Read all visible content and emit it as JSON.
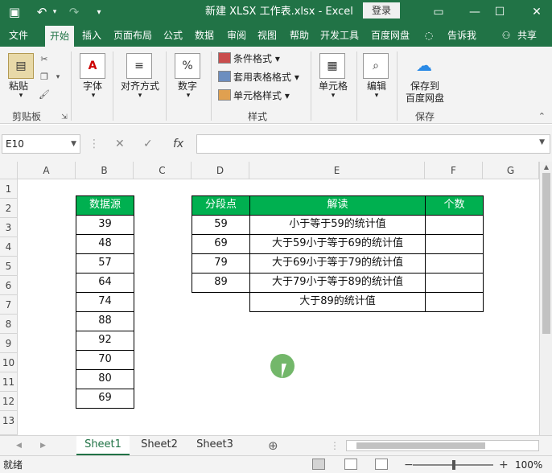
{
  "titlebar": {
    "title": "新建 XLSX 工作表.xlsx  -  Excel",
    "login": "登录",
    "save_icon": "save-icon",
    "undo_icon": "undo-icon",
    "redo_icon": "redo-icon"
  },
  "tabs": [
    "文件",
    "开始",
    "插入",
    "页面布局",
    "公式",
    "数据",
    "审阅",
    "视图",
    "帮助",
    "开发工具",
    "百度网盘",
    "告诉我",
    "共享"
  ],
  "ribbon": {
    "paste": "粘贴",
    "clipboard": "剪贴板",
    "font": "字体",
    "align": "对齐方式",
    "number": "数字",
    "cond_format": "条件格式",
    "table_format": "套用表格格式",
    "cell_style": "单元格样式",
    "styles": "样式",
    "cells": "单元格",
    "edit": "编辑",
    "save_to": "保存到",
    "baidu_pan": "百度网盘",
    "save": "保存"
  },
  "formula_bar": {
    "name_box": "E10",
    "value": ""
  },
  "columns": [
    "A",
    "B",
    "C",
    "D",
    "E",
    "F",
    "G"
  ],
  "rows": [
    "1",
    "2",
    "3",
    "4",
    "5",
    "6",
    "7",
    "8",
    "9",
    "10",
    "11",
    "12",
    "13"
  ],
  "table1": {
    "header": "数据源",
    "values": [
      "39",
      "48",
      "57",
      "64",
      "74",
      "88",
      "92",
      "70",
      "80",
      "69"
    ]
  },
  "table2": {
    "headers": [
      "分段点",
      "解读",
      "个数"
    ],
    "rows": [
      [
        "59",
        "小于等于59的统计值",
        ""
      ],
      [
        "69",
        "大于59小于等于69的统计值",
        ""
      ],
      [
        "79",
        "大于69小于等于79的统计值",
        ""
      ],
      [
        "89",
        "大于79小于等于89的统计值",
        ""
      ],
      [
        "",
        "大于89的统计值",
        ""
      ]
    ]
  },
  "sheets": [
    "Sheet1",
    "Sheet2",
    "Sheet3"
  ],
  "status": {
    "text": "就绪",
    "zoom": "100%"
  },
  "colors": {
    "excel_green": "#217346",
    "header_green": "#00b050"
  }
}
